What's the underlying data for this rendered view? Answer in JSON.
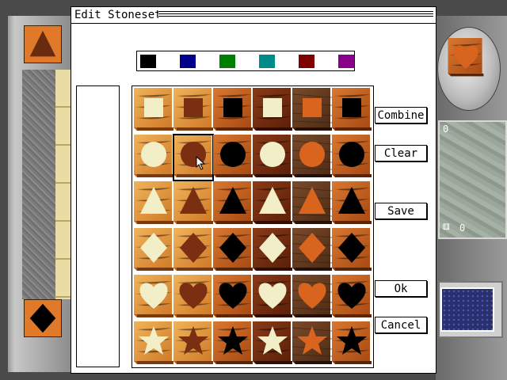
{
  "dialog": {
    "title": "Edit Stoneset"
  },
  "colors": [
    {
      "name": "black",
      "hex": "#000000"
    },
    {
      "name": "navy",
      "hex": "#00008b"
    },
    {
      "name": "green",
      "hex": "#008000"
    },
    {
      "name": "teal",
      "hex": "#008b8b"
    },
    {
      "name": "dark-red",
      "hex": "#800000"
    },
    {
      "name": "purple",
      "hex": "#8b008b"
    }
  ],
  "tile_grid": {
    "shapes": [
      "square",
      "circle",
      "triangle",
      "diamond",
      "heart",
      "star"
    ],
    "variants": [
      {
        "wood": "light",
        "symbol": "cream"
      },
      {
        "wood": "light",
        "symbol": "dark-wood"
      },
      {
        "wood": "medium",
        "symbol": "black"
      },
      {
        "wood": "dark",
        "symbol": "cream"
      },
      {
        "wood": "striped",
        "symbol": "orange-wood"
      },
      {
        "wood": "medium",
        "symbol": "black"
      }
    ],
    "selected": {
      "row": 1,
      "col": 1
    }
  },
  "buttons": {
    "combine": "Combine",
    "clear": "Clear",
    "save": "Save",
    "ok": "Ok",
    "cancel": "Cancel"
  },
  "side_panel": {
    "score_top": "0",
    "score_bottom": "0",
    "tree_icon": "tree-icon",
    "preview_shape": "heart"
  },
  "board_tiles": [
    {
      "shape": "triangle"
    },
    {
      "shape": "diamond"
    }
  ]
}
